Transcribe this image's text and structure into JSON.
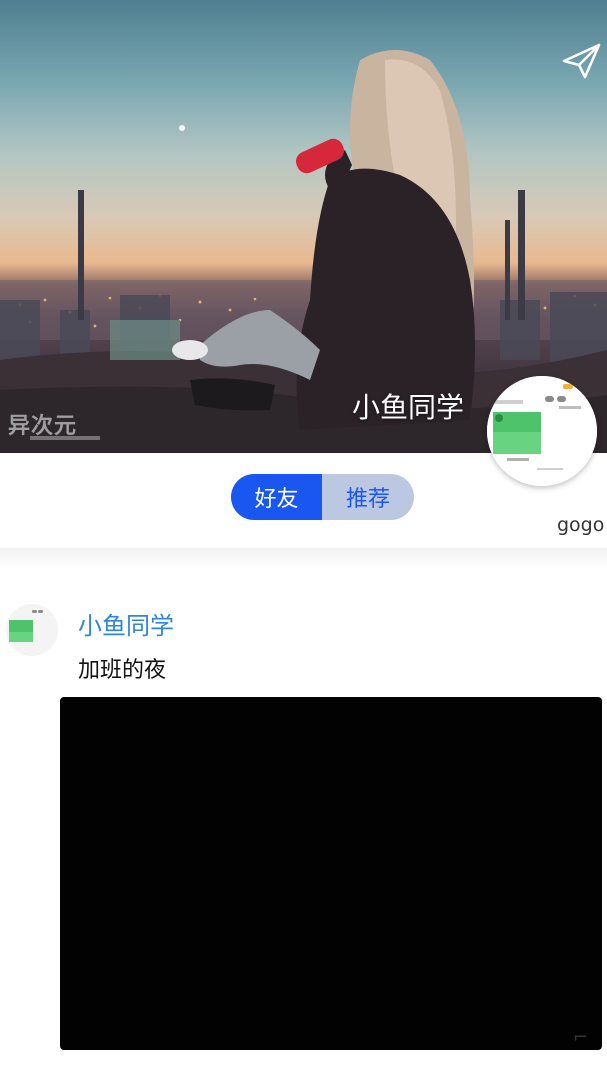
{
  "profile": {
    "name": "小鱼同学",
    "cover_watermark": "异次元"
  },
  "tabs": [
    {
      "label": "好友",
      "active": true
    },
    {
      "label": "推荐",
      "active": false
    }
  ],
  "side_label": "gogo",
  "post": {
    "author": "小鱼同学",
    "text": "加班的夜"
  },
  "colors": {
    "accent": "#1a57f0",
    "tab_inactive_bg": "#bcc8e1",
    "author_link": "#2f86d8"
  },
  "icons": {
    "share": "paper-plane-icon"
  }
}
